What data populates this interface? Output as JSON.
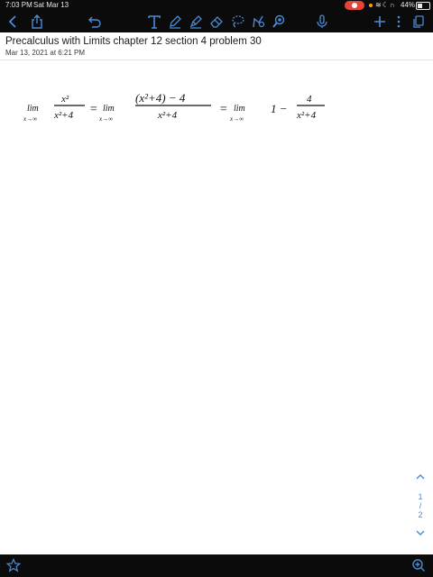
{
  "status_bar": {
    "time": "7:03 PM",
    "date": "Sat Mar 13",
    "battery": "44%"
  },
  "toolbar": {
    "left_icons": [
      "chevron-left-icon",
      "share-icon",
      "undo-icon"
    ],
    "tools": [
      "text-tool-icon",
      "pen-icon",
      "highlighter-icon",
      "eraser-icon",
      "lasso-icon",
      "shapes-icon",
      "laser-pointer-icon"
    ],
    "right_icons": [
      "microphone-icon",
      "add-icon",
      "more-icon",
      "pages-icon"
    ]
  },
  "note": {
    "title": "Precalculus with Limits chapter 12 section 4 problem 30",
    "subtitle": "Mar 13, 2021 at 6:21 PM"
  },
  "handwriting": {
    "term1_lim": "lim",
    "term1_sub": "x→∞",
    "term1_num": "x²",
    "term1_den": "x²+4",
    "term2_lim": "lim",
    "term2_sub": "x→∞",
    "term2_num": "(x²+4) − 4",
    "term2_den": "x²+4",
    "term3_lim": "lim",
    "term3_sub": "x→∞",
    "term3_one": "1 −",
    "term3_num": "4",
    "term3_den": "x²+4",
    "equals": "="
  },
  "pager": {
    "current": "1",
    "separator": "/",
    "total": "2"
  },
  "colors": {
    "accent": "#4a8bd6",
    "bar_bg": "#0b0b0c",
    "record": "#e5443b"
  }
}
